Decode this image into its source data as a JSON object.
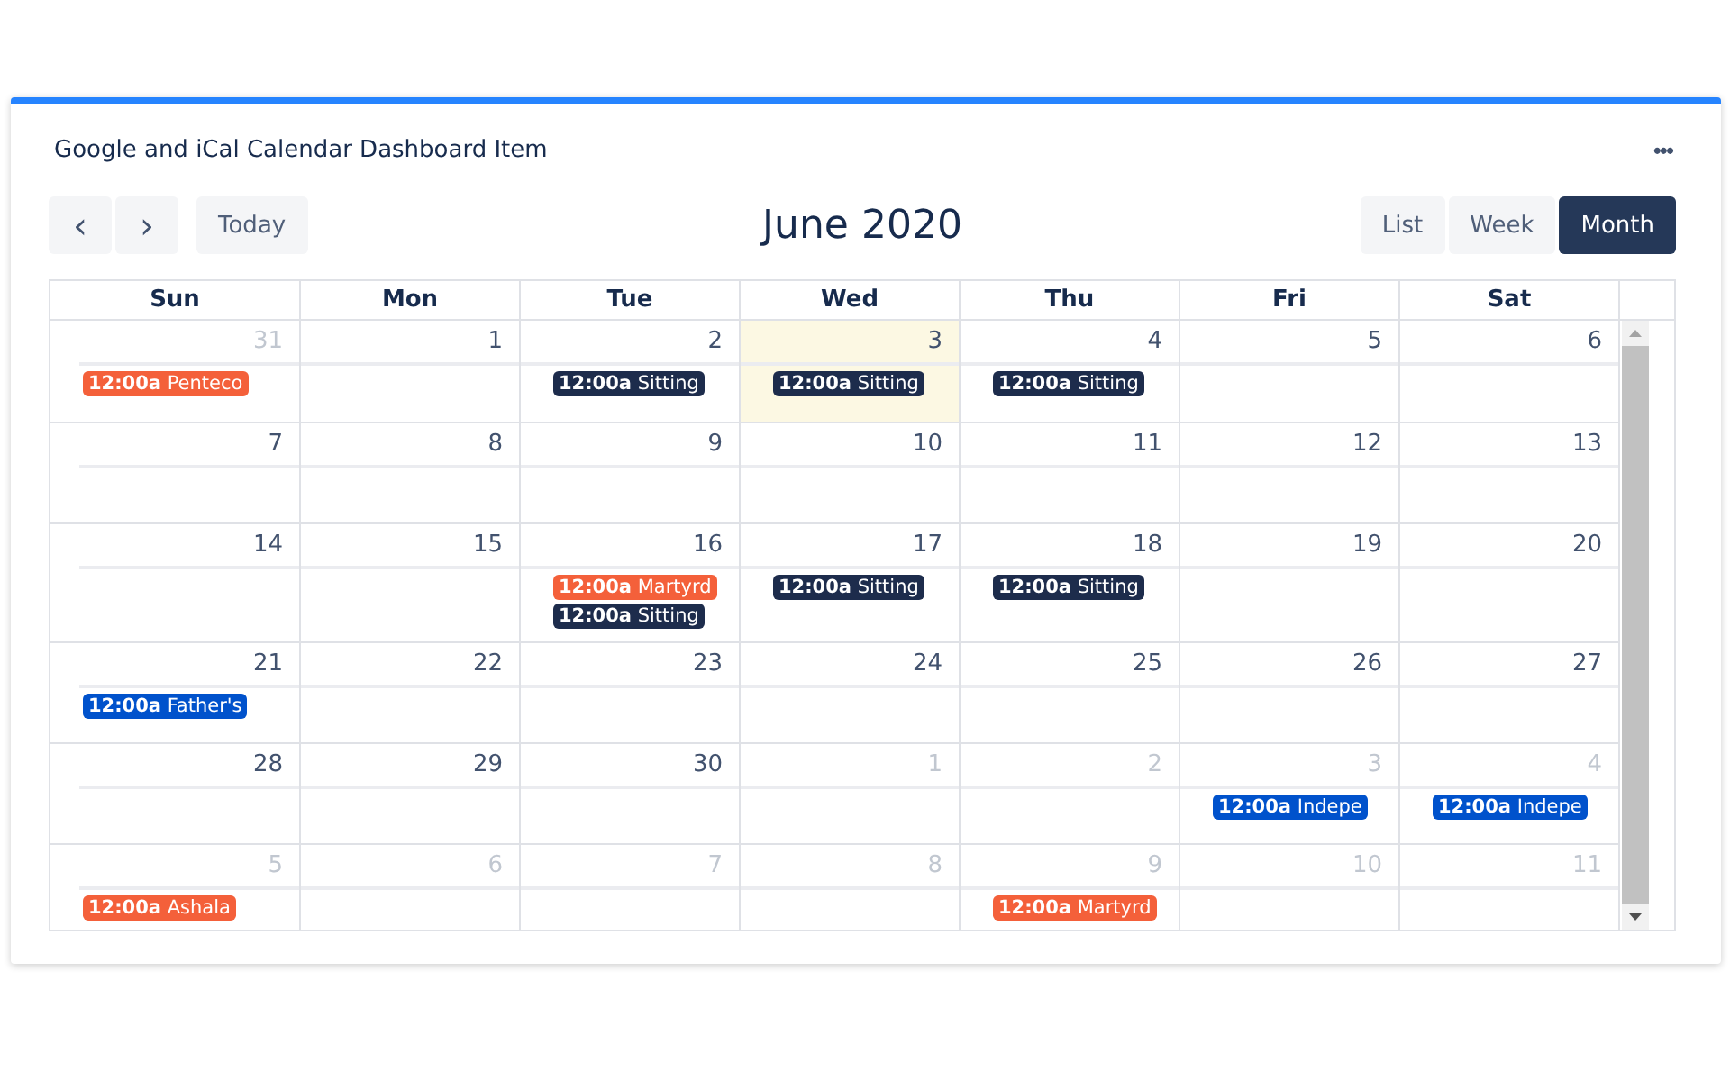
{
  "widget": {
    "title": "Google and iCal Calendar Dashboard Item",
    "menu": "•••"
  },
  "toolbar": {
    "prev": "‹",
    "next": "›",
    "today": "Today",
    "heading": "June 2020",
    "views": [
      {
        "label": "List",
        "selected": false
      },
      {
        "label": "Week",
        "selected": false
      },
      {
        "label": "Month",
        "selected": true
      }
    ]
  },
  "weekdays": [
    "Sun",
    "Mon",
    "Tue",
    "Wed",
    "Thu",
    "Fri",
    "Sat"
  ],
  "weeks": [
    [
      {
        "day": "31",
        "muted": true,
        "today": false,
        "events": [
          {
            "time": "12:00a",
            "title": "Penteco",
            "color": "#f4603a"
          }
        ]
      },
      {
        "day": "1",
        "muted": false,
        "today": false
      },
      {
        "day": "2",
        "muted": false,
        "today": false,
        "events": [
          {
            "time": "12:00a",
            "title": "Sitting",
            "color": "#1d2c4c"
          }
        ]
      },
      {
        "day": "3",
        "muted": false,
        "today": true,
        "events": [
          {
            "time": "12:00a",
            "title": "Sitting",
            "color": "#1d2c4c"
          }
        ]
      },
      {
        "day": "4",
        "muted": false,
        "today": false,
        "events": [
          {
            "time": "12:00a",
            "title": "Sitting",
            "color": "#1d2c4c"
          }
        ]
      },
      {
        "day": "5",
        "muted": false,
        "today": false
      },
      {
        "day": "6",
        "muted": false,
        "today": false
      }
    ],
    [
      {
        "day": "7",
        "muted": false,
        "today": false
      },
      {
        "day": "8",
        "muted": false,
        "today": false
      },
      {
        "day": "9",
        "muted": false,
        "today": false
      },
      {
        "day": "10",
        "muted": false,
        "today": false
      },
      {
        "day": "11",
        "muted": false,
        "today": false
      },
      {
        "day": "12",
        "muted": false,
        "today": false
      },
      {
        "day": "13",
        "muted": false,
        "today": false
      }
    ],
    [
      {
        "day": "14",
        "muted": false,
        "today": false
      },
      {
        "day": "15",
        "muted": false,
        "today": false
      },
      {
        "day": "16",
        "muted": false,
        "today": false,
        "events": [
          {
            "time": "12:00a",
            "title": "Martyrd",
            "color": "#f4603a"
          },
          {
            "time": "12:00a",
            "title": "Sitting",
            "color": "#1d2c4c"
          }
        ]
      },
      {
        "day": "17",
        "muted": false,
        "today": false,
        "events": [
          {
            "time": "12:00a",
            "title": "Sitting",
            "color": "#1d2c4c"
          }
        ]
      },
      {
        "day": "18",
        "muted": false,
        "today": false,
        "events": [
          {
            "time": "12:00a",
            "title": "Sitting",
            "color": "#1d2c4c"
          }
        ]
      },
      {
        "day": "19",
        "muted": false,
        "today": false
      },
      {
        "day": "20",
        "muted": false,
        "today": false
      }
    ],
    [
      {
        "day": "21",
        "muted": false,
        "today": false,
        "events": [
          {
            "time": "12:00a",
            "title": "Father's",
            "color": "#0052cc"
          }
        ]
      },
      {
        "day": "22",
        "muted": false,
        "today": false
      },
      {
        "day": "23",
        "muted": false,
        "today": false
      },
      {
        "day": "24",
        "muted": false,
        "today": false
      },
      {
        "day": "25",
        "muted": false,
        "today": false
      },
      {
        "day": "26",
        "muted": false,
        "today": false
      },
      {
        "day": "27",
        "muted": false,
        "today": false
      }
    ],
    [
      {
        "day": "28",
        "muted": false,
        "today": false
      },
      {
        "day": "29",
        "muted": false,
        "today": false
      },
      {
        "day": "30",
        "muted": false,
        "today": false
      },
      {
        "day": "1",
        "muted": true,
        "today": false
      },
      {
        "day": "2",
        "muted": true,
        "today": false
      },
      {
        "day": "3",
        "muted": true,
        "today": false,
        "events": [
          {
            "time": "12:00a",
            "title": "Indepe",
            "color": "#0052cc"
          }
        ]
      },
      {
        "day": "4",
        "muted": true,
        "today": false,
        "events": [
          {
            "time": "12:00a",
            "title": "Indepe",
            "color": "#0052cc"
          }
        ]
      }
    ],
    [
      {
        "day": "5",
        "muted": true,
        "today": false,
        "events": [
          {
            "time": "12:00a",
            "title": "Ashala",
            "color": "#f4603a"
          }
        ]
      },
      {
        "day": "6",
        "muted": true,
        "today": false
      },
      {
        "day": "7",
        "muted": true,
        "today": false
      },
      {
        "day": "8",
        "muted": true,
        "today": false
      },
      {
        "day": "9",
        "muted": true,
        "today": false,
        "events": [
          {
            "time": "12:00a",
            "title": "Martyrd",
            "color": "#f4603a"
          }
        ]
      },
      {
        "day": "10",
        "muted": true,
        "today": false
      },
      {
        "day": "11",
        "muted": true,
        "today": false
      }
    ]
  ]
}
